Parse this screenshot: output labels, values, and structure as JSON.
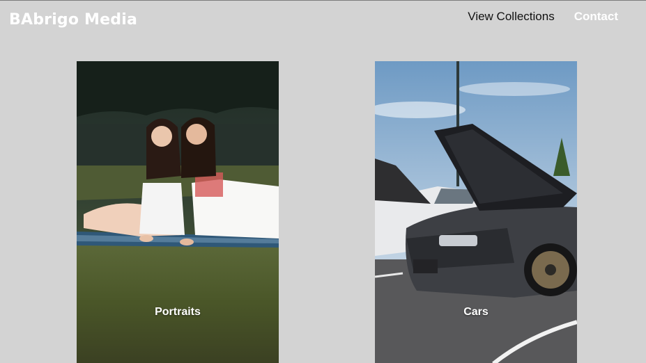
{
  "header": {
    "brand": "BAbrigo Media",
    "nav": [
      {
        "label": "View Collections"
      },
      {
        "label": "Contact"
      }
    ]
  },
  "gallery": [
    {
      "caption": "Portraits",
      "image": "two women sitting on a blanket in grass"
    },
    {
      "caption": "Cars",
      "image": "dark sports car with open hood at car meet"
    }
  ],
  "colors": {
    "background": "#d3d3d3",
    "brand_text": "#ffffff",
    "nav_text": "#111111",
    "nav_active": "#ffffff"
  }
}
